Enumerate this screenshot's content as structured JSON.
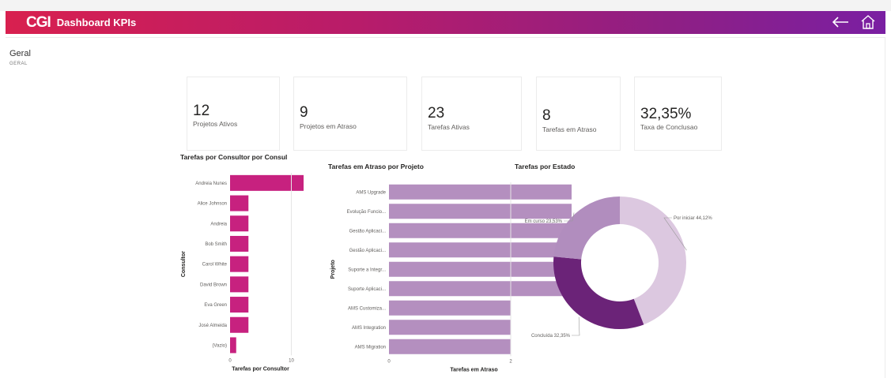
{
  "header": {
    "logo": "CGI",
    "title": "Dashboard KPIs",
    "gradient_start": "#d8204f",
    "gradient_end": "#7a1fa2",
    "icons": [
      "back-arrow-icon",
      "home-icon"
    ]
  },
  "page": {
    "section_title": "Geral",
    "section_subtitle": "GERAL"
  },
  "kpis": [
    {
      "value": "12",
      "label": "Projetos Ativos"
    },
    {
      "value": "9",
      "label": "Projetos em Atraso"
    },
    {
      "value": "23",
      "label": "Tarefas Ativas"
    },
    {
      "value": "8",
      "label": "Tarefas em Atraso"
    },
    {
      "value": "32,35%",
      "label": "Taxa de Conclusao"
    }
  ],
  "chart_data": [
    {
      "type": "bar",
      "orientation": "horizontal",
      "title": "Tarefas por Consultor por Consul",
      "ylabel": "Consultor",
      "xlabel": "Tarefas por Consultor",
      "categories": [
        "Andreia Nunes",
        "Alice Johnson",
        "Andreia",
        "Bob Smith",
        "Carol White",
        "David Brown",
        "Eva Green",
        "José Almeida",
        "(Vazio)"
      ],
      "values": [
        12,
        3,
        3,
        3,
        3,
        3,
        3,
        3,
        1
      ],
      "xlim": [
        0,
        12
      ],
      "xticks": [
        "0",
        "10"
      ],
      "color": "#c7217f"
    },
    {
      "type": "bar",
      "orientation": "horizontal",
      "title": "Tarefas em Atraso por Projeto",
      "ylabel": "Projeto",
      "xlabel": "Tarefas em Atraso",
      "categories": [
        "AMS Upgrade",
        "Evolução Funcio...",
        "Gestão Aplicaci...",
        "Gestão Aplicaci...",
        "Suporte a Integr...",
        "Suporte Aplicaci...",
        "AMS Customiza...",
        "AMS Integration",
        "AMS Migration"
      ],
      "values": [
        3,
        3,
        3,
        3,
        3,
        3,
        2,
        2,
        2
      ],
      "xlim": [
        0,
        3
      ],
      "xticks": [
        "0",
        "2"
      ],
      "color": "#b48fbf"
    },
    {
      "type": "pie",
      "donut": true,
      "title": "Tarefas por Estado",
      "slices": [
        {
          "label": "Por iniciar 44,12%",
          "value": 44.12,
          "color": "#dcc8e0"
        },
        {
          "label": "Concluída 32,35%",
          "value": 32.35,
          "color": "#6b2378"
        },
        {
          "label": "Em curso 23,53%",
          "value": 23.53,
          "color": "#b18dbe"
        }
      ]
    }
  ]
}
